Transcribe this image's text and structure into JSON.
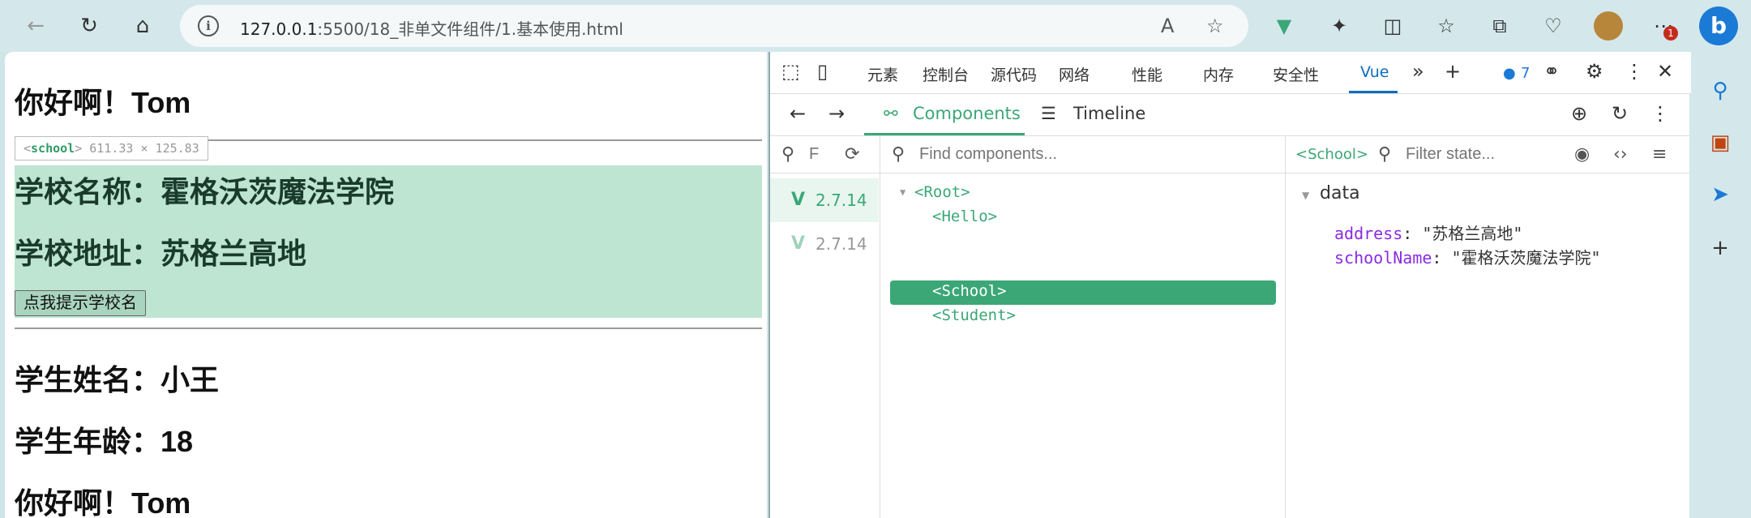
{
  "browser": {
    "url_host": "127.0.0.1",
    "url_rest": ":5500/18_非单文件组件/1.基本使用.html",
    "badge_count": "1",
    "info_glyph": "i"
  },
  "page": {
    "hello1": "你好啊！Tom",
    "tooltip_tag": "school",
    "tooltip_size": "611.33 × 125.83",
    "school_name": "学校名称：霍格沃茨魔法学院",
    "school_address": "学校地址：苏格兰高地",
    "button_label": "点我提示学校名",
    "student_name": "学生姓名：小王",
    "student_age": "学生年龄：18",
    "hello2": "你好啊！Tom"
  },
  "devtools": {
    "tabs": [
      "元素",
      "控制台",
      "源代码",
      "网络",
      "性能",
      "内存",
      "安全性",
      "Vue"
    ],
    "active_tab": "Vue",
    "issues_count": "7"
  },
  "vue": {
    "components_tab": "Components",
    "timeline_tab": "Timeline",
    "filter_short_placeholder": "F",
    "find_placeholder": "Find components...",
    "state_placeholder": "Filter state...",
    "versions": [
      "2.7.14",
      "2.7.14"
    ],
    "tree": [
      "<Root>",
      "<Hello>",
      "<School>",
      "<Student>"
    ],
    "selected_component": "<School>",
    "state_section": "data",
    "state": [
      {
        "key": "address",
        "value": "\"苏格兰高地\""
      },
      {
        "key": "schoolName",
        "value": "\"霍格沃茨魔法学院\""
      }
    ]
  },
  "colors": {
    "vue_green": "#3ba776",
    "highlight": "#bde5d2",
    "edge_blue": "#0f6cbd"
  }
}
